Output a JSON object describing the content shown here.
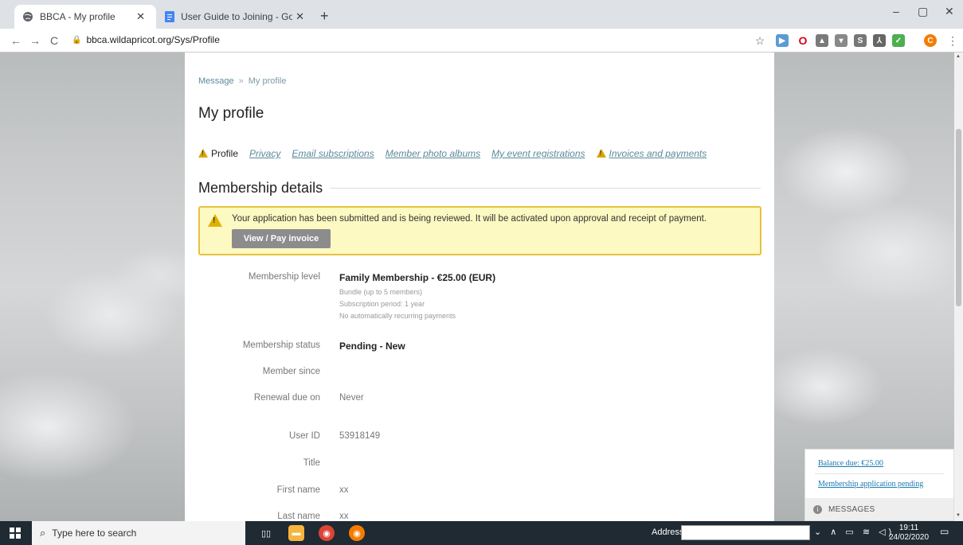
{
  "browser": {
    "tabs": [
      {
        "title": "BBCA - My profile",
        "active": true
      },
      {
        "title": "User Guide to Joining - Google D",
        "active": false
      }
    ],
    "new_tab": "+",
    "url": "bbca.wildapricot.org/Sys/Profile",
    "window_controls": {
      "minimize": "–",
      "maximize": "▢",
      "close": "✕"
    }
  },
  "page": {
    "breadcrumb": {
      "link": "Message",
      "sep": "»",
      "current": "My profile"
    },
    "title": "My profile",
    "subnav": {
      "current": "Profile",
      "links": [
        "Privacy",
        "Email subscriptions",
        "Member photo albums",
        "My event registrations",
        "Invoices and payments"
      ]
    },
    "section_title": "Membership details",
    "notice": {
      "message": "Your application has been submitted and is being reviewed. It will be activated upon approval and receipt of payment.",
      "button": "View / Pay invoice"
    },
    "fields": {
      "membership_level": {
        "label": "Membership level",
        "value": "Family Membership - €25.00 (EUR)",
        "sub1": "Bundle (up to 5 members)",
        "sub2": "Subscription period: 1 year",
        "sub3": "No automatically recurring payments"
      },
      "membership_status": {
        "label": "Membership status",
        "value": "Pending - New"
      },
      "member_since": {
        "label": "Member since",
        "value": ""
      },
      "renewal_due": {
        "label": "Renewal due on",
        "value": "Never"
      },
      "user_id": {
        "label": "User ID",
        "value": "53918149"
      },
      "title": {
        "label": "Title",
        "value": ""
      },
      "first_name": {
        "label": "First name",
        "value": "xx"
      },
      "last_name": {
        "label": "Last name",
        "value": "xx"
      }
    }
  },
  "messages_panel": {
    "balance": "Balance due: €25.00",
    "pending": "Membership application pending",
    "footer": "MESSAGES"
  },
  "taskbar": {
    "search_placeholder": "Type here to search",
    "address_label": "Address",
    "time": "19:11",
    "date": "24/02/2020"
  }
}
